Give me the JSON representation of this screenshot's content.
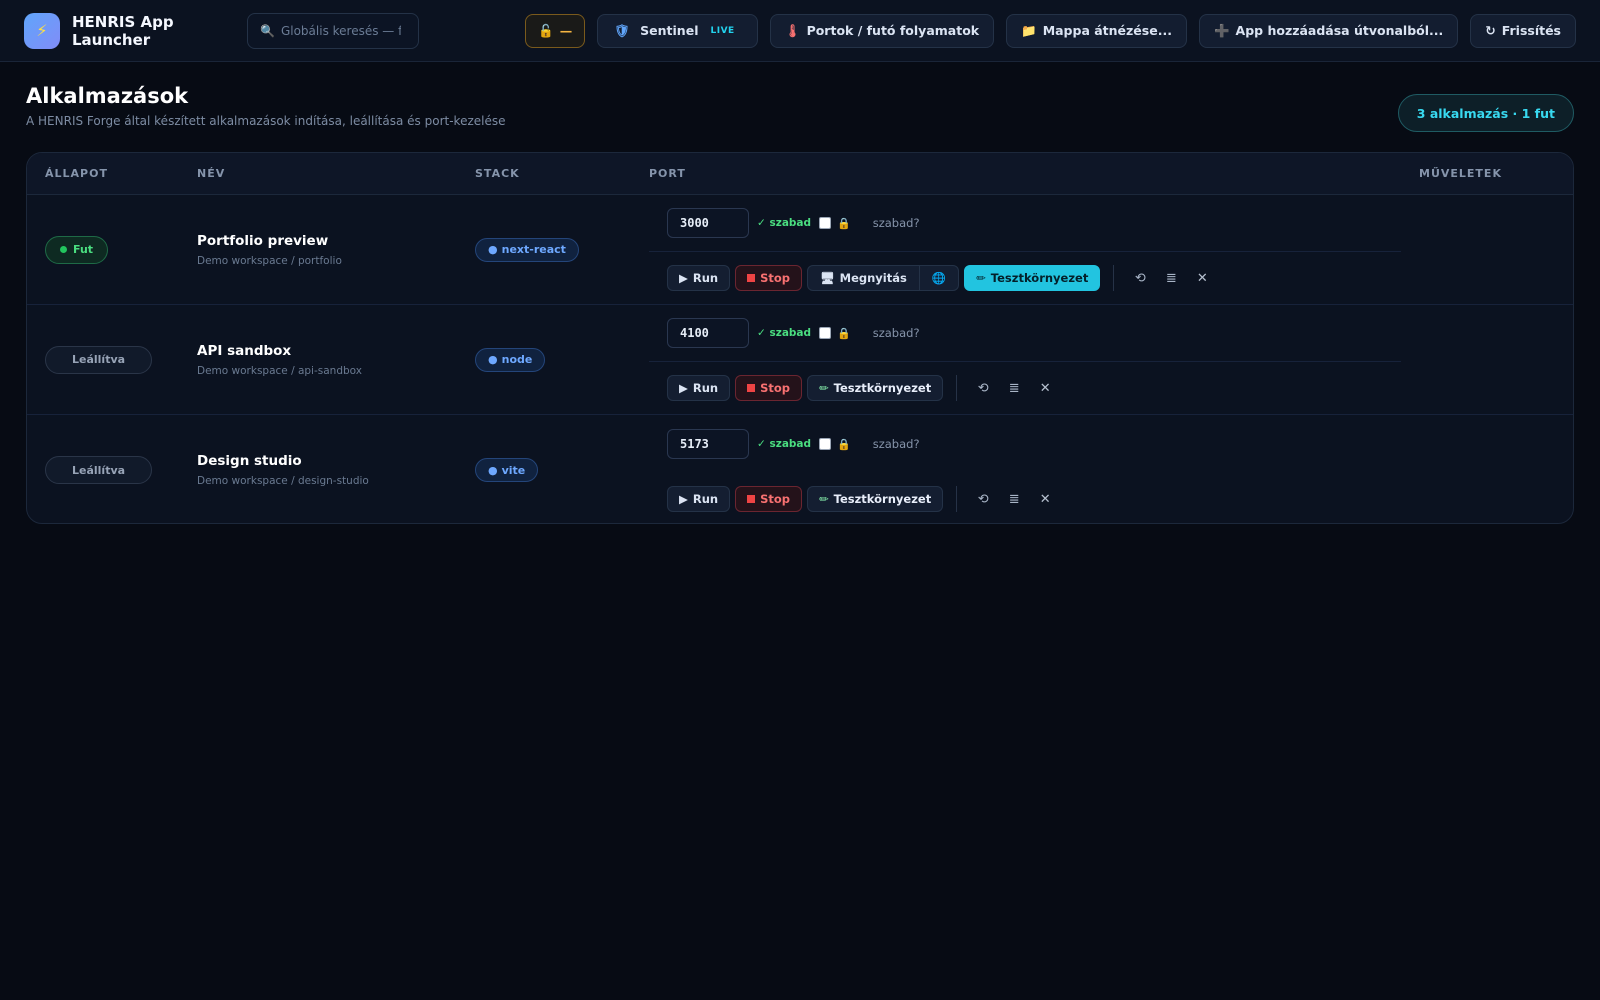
{
  "topbar": {
    "title": "HENRIS App Launcher",
    "search_placeholder": "Globális keresés — fi",
    "lock_label": "—",
    "sentinel_label": "Sentinel",
    "sentinel_badge": "LIVE",
    "ports_label": "Portok / futó folyamatok",
    "folder_label": "Mappa átnézése...",
    "add_label": "App hozzáadása útvonalból...",
    "refresh_label": "Frissítés"
  },
  "page": {
    "title": "Alkalmazások",
    "subtitle": "A HENRIS Forge által készített alkalmazások indítása, leállítása és port-kezelése",
    "summary": "3 alkalmazás · 1 fut"
  },
  "table": {
    "headers": {
      "state": "ÁLLAPOT",
      "name": "NÉV",
      "stack": "STACK",
      "port": "PORT",
      "ops": "MŰVELETEK"
    },
    "rows": [
      {
        "status": "Fut",
        "name": "Portfolio preview",
        "path": "Demo workspace / portfolio",
        "stack": "next-react",
        "port": "3000",
        "free": "✓ szabad",
        "free_q": "szabad?",
        "run": "Run",
        "stop": "Stop",
        "open": "Megnyitás",
        "test": "Tesztkörnyezet"
      },
      {
        "status": "Leállítva",
        "name": "API sandbox",
        "path": "Demo workspace / api-sandbox",
        "stack": "node",
        "port": "4100",
        "free": "✓ szabad",
        "free_q": "szabad?",
        "run": "Run",
        "stop": "Stop",
        "test": "Tesztkörnyezet"
      },
      {
        "status": "Leállítva",
        "name": "Design studio",
        "path": "Demo workspace / design-studio",
        "stack": "vite",
        "port": "5173",
        "free": "✓ szabad",
        "free_q": "szabad?",
        "run": "Run",
        "stop": "Stop",
        "test": "Tesztkörnyezet"
      }
    ]
  },
  "colors": {
    "accent": "#22c4e0",
    "running": "#4ade80",
    "stop": "#f87171",
    "stack": "#6ea8ff"
  }
}
